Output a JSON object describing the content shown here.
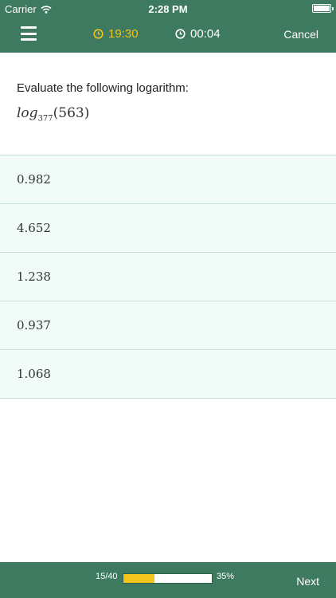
{
  "status_bar": {
    "carrier": "Carrier",
    "time": "2:28 PM",
    "wifi_icon": "wifi-icon",
    "battery_icon": "battery-icon"
  },
  "nav": {
    "menu_icon": "hamburger-menu-icon",
    "time_remaining": "19:30",
    "time_elapsed": "00:04",
    "cancel_label": "Cancel",
    "remaining_color": "#f2c41c"
  },
  "question": {
    "prompt": "Evaluate the following logarithm:",
    "expression": {
      "function": "log",
      "base": "377",
      "argument": "(563)"
    }
  },
  "answers": [
    "0.982",
    "4.652",
    "1.238",
    "0.937",
    "1.068"
  ],
  "footer": {
    "counter": "15/40",
    "progress_fraction": 0.35,
    "percent": "35%",
    "next_label": "Next"
  },
  "colors": {
    "bar": "#3d7a5f",
    "accent": "#f2c41c",
    "answer_bg": "#f1fcf9"
  }
}
